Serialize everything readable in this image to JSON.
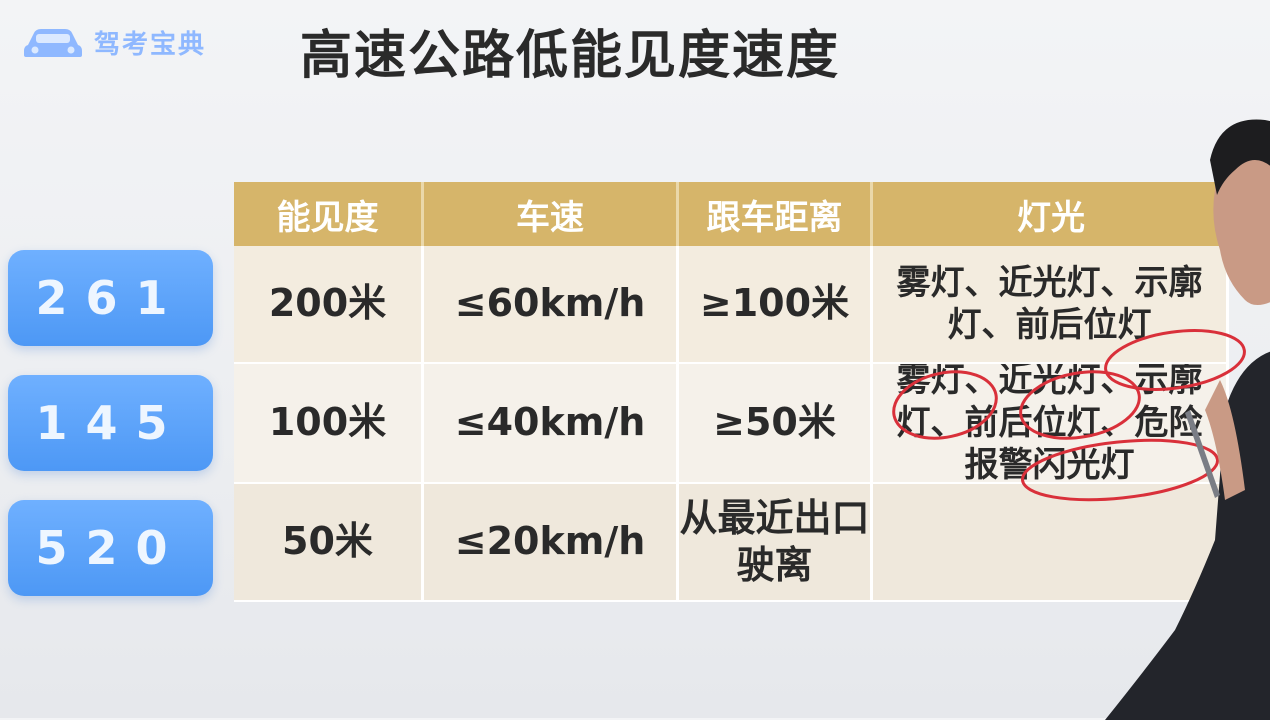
{
  "logo": {
    "text": "驾考宝典",
    "icon": "car-icon",
    "color": "#8fb8ff"
  },
  "title": "高速公路低能见度速度",
  "codes": [
    {
      "label": "261"
    },
    {
      "label": "145"
    },
    {
      "label": "520"
    }
  ],
  "table": {
    "headers": [
      "能见度",
      "车速",
      "跟车距离",
      "灯光"
    ],
    "rows": [
      {
        "visibility": "200米",
        "speed": "≤60km/h",
        "distance": "≥100米",
        "lights": "雾灯、近光灯、示廓灯、前后位灯"
      },
      {
        "visibility": "100米",
        "speed": "≤40km/h",
        "distance": "≥50米",
        "lights": "雾灯、近光灯、示廓灯、前后位灯、危险报警闪光灯"
      },
      {
        "visibility": "50米",
        "speed": "≤20km/h",
        "distance": "从最近出口驶离",
        "lights": ""
      }
    ]
  },
  "colors": {
    "header_bg": "#d6b56a",
    "code_button": "#5ea3f8",
    "annotation": "#d9303a"
  }
}
